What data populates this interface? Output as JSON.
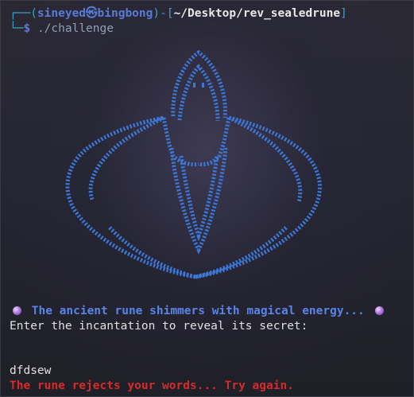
{
  "prompt": {
    "corner_top": "┌──(",
    "user": "sineyed",
    "host_sep_icon": "kali-skull-icon",
    "host": "bingbong",
    "close_paren": ")-[",
    "path": "~/Desktop/rev_sealedrune",
    "close_bracket": "]",
    "corner_bottom": "└─",
    "dollar": "$",
    "command": "./challenge"
  },
  "art": {
    "description_icon": "rune-ascii-art",
    "dot_color": "#3d78d8"
  },
  "output": {
    "shimmer_text": "The ancient rune shimmers with magical energy...",
    "enter_text": "Enter the incantation to reveal its secret:",
    "user_input": "dfdsew",
    "reject_text": "The rune rejects your words... Try again."
  },
  "colors": {
    "background": "#26262f",
    "prompt_cyan": "#3ea0c8",
    "shimmer_blue": "#5a84e8",
    "error_red": "#d82a2a"
  }
}
